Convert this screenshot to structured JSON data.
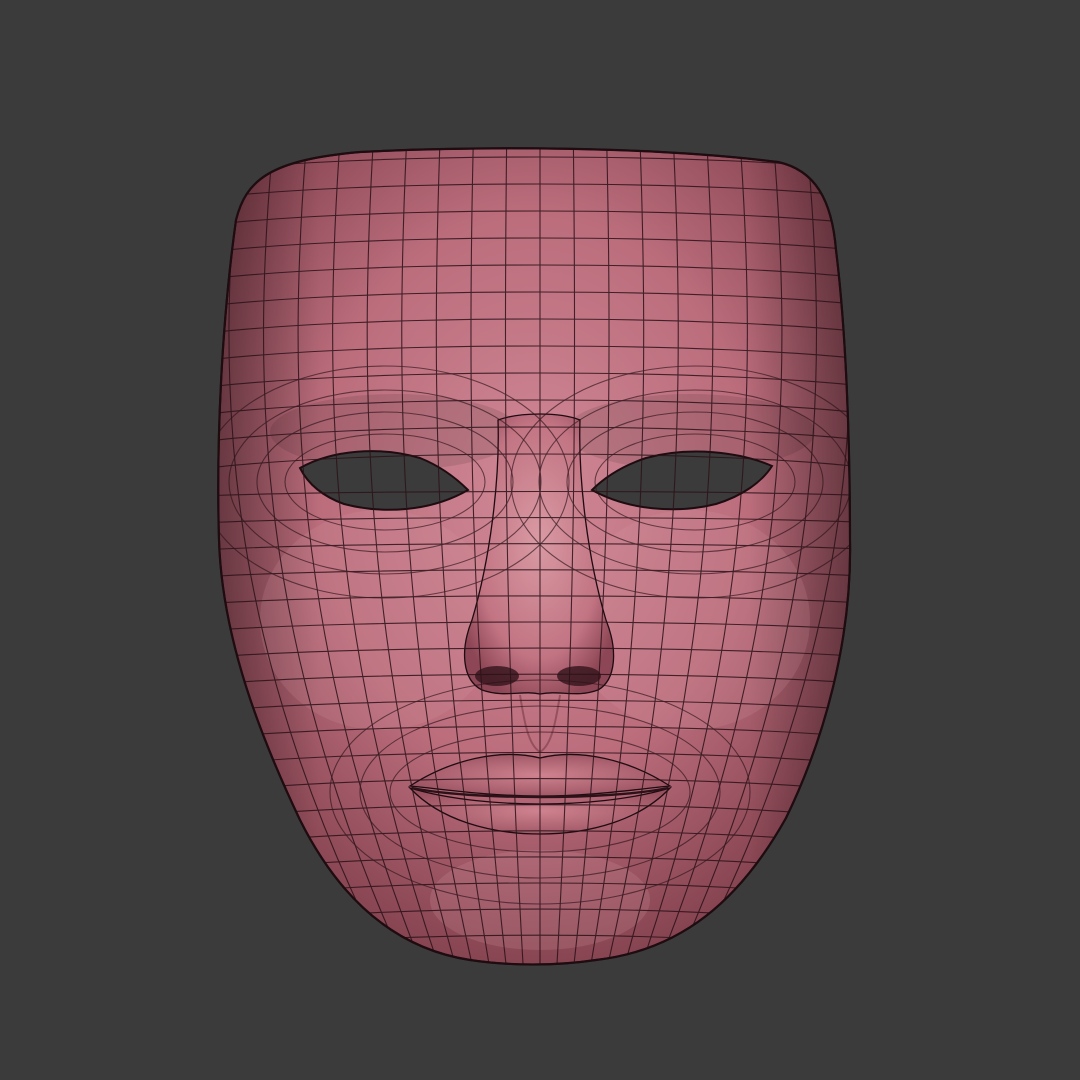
{
  "scene": {
    "subject": "face-mask-wireframe",
    "background_color": "#3b3b3b",
    "mesh_color": "#c06e7e",
    "mesh_highlight_color": "#d58d97",
    "mesh_shadow_color": "#7e3f4c",
    "wire_color": "#2b1218",
    "view": "front"
  }
}
